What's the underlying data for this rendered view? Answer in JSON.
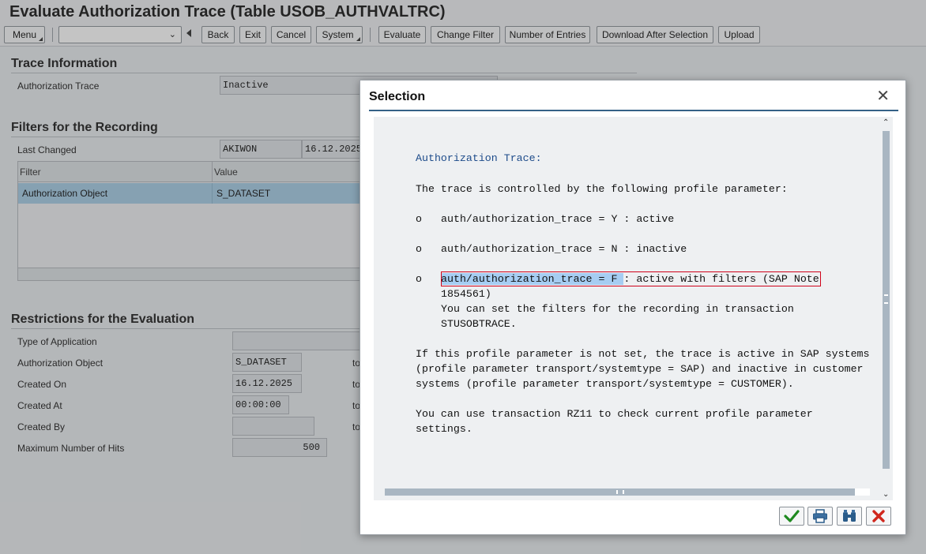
{
  "window": {
    "title": "Evaluate Authorization Trace (Table USOB_AUTHVALTRC)"
  },
  "toolbar": {
    "menu": "Menu",
    "back": "Back",
    "exit": "Exit",
    "cancel": "Cancel",
    "system": "System",
    "evaluate": "Evaluate",
    "change_filter": "Change Filter",
    "number_of_entries": "Number of Entries",
    "download_after_selection": "Download After Selection",
    "upload": "Upload"
  },
  "trace_info": {
    "heading": "Trace Information",
    "label": "Authorization Trace",
    "value": "Inactive"
  },
  "filters": {
    "heading": "Filters for the Recording",
    "last_changed_label": "Last Changed",
    "last_changed_user": "AKIWON",
    "last_changed_date": "16.12.2025",
    "table": {
      "col_filter": "Filter",
      "col_value": "Value",
      "row_filter": "Authorization Object",
      "row_value": "S_DATASET"
    }
  },
  "restrictions": {
    "heading": "Restrictions for the Evaluation",
    "type_of_application": "Type of Application",
    "authorization_object": "Authorization Object",
    "authorization_object_value": "S_DATASET",
    "created_on": "Created On",
    "created_on_value": "16.12.2025",
    "created_at": "Created At",
    "created_at_value": "00:00:00",
    "created_by": "Created By",
    "max_hits": "Maximum Number of Hits",
    "max_hits_value": "500",
    "to_label": "to"
  },
  "dialog": {
    "title": "Selection",
    "text": {
      "heading": "Authorization Trace:",
      "intro": "The trace is controlled by the following profile parameter:",
      "bullet": "o",
      "item_y": "auth/authorization_trace = Y : active",
      "item_n": "auth/authorization_trace = N : inactive",
      "item_f_selected": "auth/authorization_trace = F ",
      "item_f_rest": ": active with filters (SAP Note",
      "item_f_note": "1854561)",
      "item_f_desc1": "You can set the filters for the recording in transaction",
      "item_f_desc2": "STUSOBTRACE.",
      "para2_l1": "If this profile parameter is not set, the trace is active in SAP systems",
      "para2_l2": "(profile parameter transport/systemtype = SAP) and inactive in customer",
      "para2_l3": "systems (profile parameter transport/systemtype = CUSTOMER).",
      "para3_l1": "You can use transaction RZ11 to check current profile parameter",
      "para3_l2": "settings."
    },
    "buttons": [
      "check-icon",
      "print-icon",
      "binoculars-icon",
      "cancel-x-icon"
    ]
  }
}
